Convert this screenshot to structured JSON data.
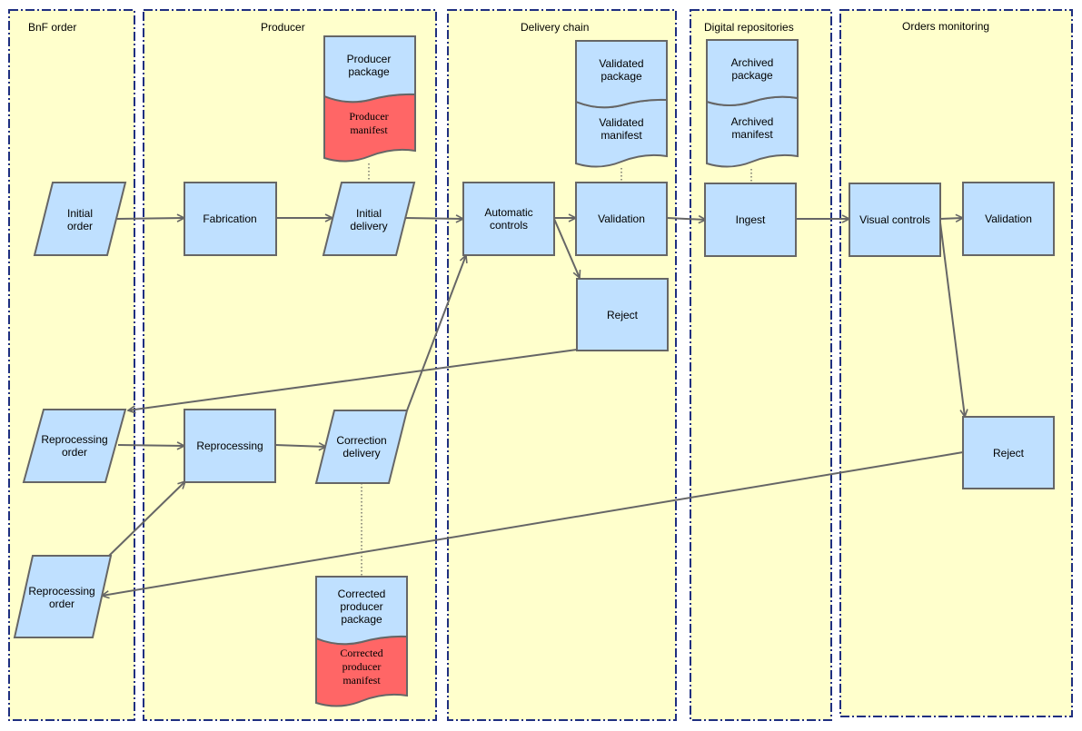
{
  "lanes": {
    "bnf": "BnF order",
    "producer": "Producer",
    "delivery": "Delivery chain",
    "repositories": "Digital repositories",
    "monitoring": "Orders monitoring"
  },
  "nodes": {
    "initial_order": [
      "Initial",
      "order"
    ],
    "fabrication": "Fabrication",
    "initial_delivery": [
      "Initial",
      "delivery"
    ],
    "producer_package": [
      "Producer",
      "package"
    ],
    "producer_manifest": [
      "Producer",
      "manifest"
    ],
    "automatic_controls": [
      "Automatic",
      "controls"
    ],
    "validation_delivery": "Validation",
    "validated_package": [
      "Validated",
      "package"
    ],
    "validated_manifest": [
      "Validated",
      "manifest"
    ],
    "reject_delivery": "Reject",
    "archived_package": [
      "Archived",
      "package"
    ],
    "archived_manifest": [
      "Archived",
      "manifest"
    ],
    "ingest": "Ingest",
    "visual_controls": "Visual controls",
    "validation_monitoring": "Validation",
    "reject_monitoring": "Reject",
    "reprocessing_order_1": [
      "Reprocessing",
      "order"
    ],
    "reprocessing": "Reprocessing",
    "correction_delivery": [
      "Correction",
      "delivery"
    ],
    "corrected_package": [
      "Corrected",
      "producer",
      "package"
    ],
    "corrected_manifest": [
      "Corrected",
      "producer",
      "manifest"
    ],
    "reprocessing_order_2": [
      "Reprocessing",
      "order"
    ]
  },
  "colors": {
    "lane_fill": "#ffffcc",
    "lane_border": "#1f2f80",
    "node_fill": "#bfe0ff",
    "manifest_fill": "#ff6666"
  }
}
